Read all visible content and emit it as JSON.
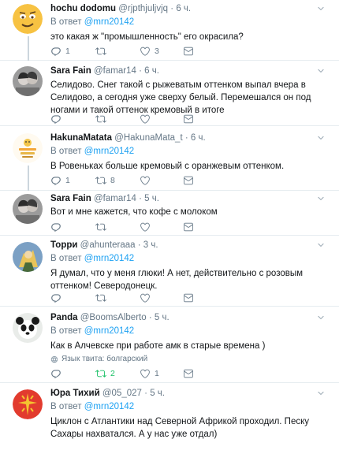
{
  "tweets": [
    {
      "name": "hochu dodomu",
      "handle": "@rjpthjuljvjq",
      "dot": "·",
      "time": "6 ч.",
      "replying_prefix": "В ответ",
      "replying_to": "@mrn20142",
      "text": "это какая ж \"промышленность\" его окрасила?",
      "replies": "1",
      "retweets": "",
      "likes": "3",
      "avatar": "emoji-face",
      "avatar_color": "#f7c242"
    },
    {
      "name": "Sara Fain",
      "handle": "@famar14",
      "dot": "·",
      "time": "6 ч.",
      "text": "Селидово. Снег такой с рыжеватым оттенком выпал вчера в Селидово, а сегодня уже сверху белый. Перемешался он под ногами и такой оттенок кремовый в итоге",
      "replies": "",
      "retweets": "",
      "likes": "",
      "avatar": "couple-photo",
      "avatar_color": "#8a8a8a"
    },
    {
      "name": "HakunaMatata",
      "handle": "@HakunaMata_t",
      "dot": "·",
      "time": "6 ч.",
      "replying_prefix": "В ответ",
      "replying_to": "@mrn20142",
      "text": "В Ровеньках больше кремовый с оранжевым оттенком.",
      "replies": "1",
      "retweets": "8",
      "likes": "",
      "avatar": "hakuna-matata-logo",
      "avatar_color": "#f3c64a"
    },
    {
      "name": "Sara Fain",
      "handle": "@famar14",
      "dot": "·",
      "time": "5 ч.",
      "text": "Вот и мне кажется, что кофе с молоком",
      "replies": "",
      "retweets": "",
      "likes": "",
      "avatar": "couple-photo",
      "avatar_color": "#8a8a8a"
    },
    {
      "name": "Торри",
      "handle": "@ahunteraaa",
      "dot": "·",
      "time": "3 ч.",
      "replying_prefix": "В ответ",
      "replying_to": "@mrn20142",
      "text": "Я думал, что у меня глюки! А нет, действительно с розовым оттенком! Северодонецк.",
      "replies": "",
      "retweets": "",
      "likes": "",
      "avatar": "character-photo",
      "avatar_color": "#7ba0c4"
    },
    {
      "name": "Panda",
      "handle": "@BoomsAlberto",
      "dot": "·",
      "time": "5 ч.",
      "replying_prefix": "В ответ",
      "replying_to": "@mrn20142",
      "text": "Как в Алчевске при работе амк в старые времена )",
      "lang_label": "Язык твита: болгарский",
      "replies": "",
      "retweets": "2",
      "likes": "1",
      "retweet_active": true,
      "avatar": "panda-photo",
      "avatar_color": "#333333"
    },
    {
      "name": "Юра Тихий",
      "handle": "@05_027",
      "dot": "·",
      "time": "5 ч.",
      "replying_prefix": "В ответ",
      "replying_to": "@mrn20142",
      "text": "Циклон с Атлантики над Северной Африкой проходил. Песку Сахары нахватался. А у нас уже отдал)",
      "replies": "",
      "retweets": "",
      "likes": "",
      "avatar": "cross-emblem",
      "avatar_color": "#e23b2e"
    }
  ],
  "colors": {
    "accent": "#1da1f2",
    "muted": "#657786",
    "retweet_active": "#17bf63",
    "divider": "#e6ecf0"
  }
}
